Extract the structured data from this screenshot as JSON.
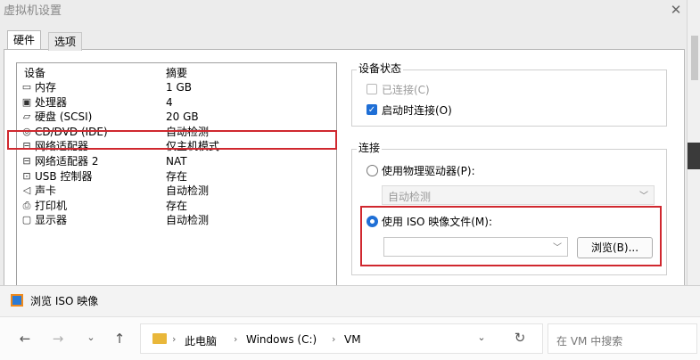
{
  "window": {
    "title": "虚拟机设置",
    "close_glyph": "✕"
  },
  "tabs": [
    {
      "label": "硬件",
      "active": true
    },
    {
      "label": "选项",
      "active": false
    }
  ],
  "device_list": {
    "col_device": "设备",
    "col_summary": "摘要",
    "rows": [
      {
        "icon": "memory-icon",
        "glyph": "▭",
        "name": "内存",
        "summary": "1 GB"
      },
      {
        "icon": "processor-icon",
        "glyph": "▣",
        "name": "处理器",
        "summary": "4"
      },
      {
        "icon": "harddisk-icon",
        "glyph": "▱",
        "name": "硬盘 (SCSI)",
        "summary": "20 GB"
      },
      {
        "icon": "cd-dvd-icon",
        "glyph": "◎",
        "name": "CD/DVD (IDE)",
        "summary": "自动检测",
        "selected": true
      },
      {
        "icon": "network-adapter-icon",
        "glyph": "⊟",
        "name": "网络适配器",
        "summary": "仅主机模式"
      },
      {
        "icon": "network-adapter-icon",
        "glyph": "⊟",
        "name": "网络适配器 2",
        "summary": "NAT"
      },
      {
        "icon": "usb-controller-icon",
        "glyph": "⊡",
        "name": "USB 控制器",
        "summary": "存在"
      },
      {
        "icon": "sound-card-icon",
        "glyph": "◁",
        "name": "声卡",
        "summary": "自动检测"
      },
      {
        "icon": "printer-icon",
        "glyph": "⎙",
        "name": "打印机",
        "summary": "存在"
      },
      {
        "icon": "display-icon",
        "glyph": "▢",
        "name": "显示器",
        "summary": "自动检测"
      }
    ]
  },
  "device_status": {
    "title": "设备状态",
    "connected_label": "已连接(C)",
    "connected_checked": false,
    "connect_at_poweron_label": "启动时连接(O)",
    "connect_at_poweron_checked": true
  },
  "connection": {
    "title": "连接",
    "physical_drive_label": "使用物理驱动器(P):",
    "physical_drive_value": "自动检测",
    "iso_label": "使用 ISO 映像文件(M):",
    "iso_value": "",
    "browse_label": "浏览(B)...",
    "selected": "iso"
  },
  "browse_dialog": {
    "title": "浏览 ISO 映像",
    "path": [
      "此电脑",
      "Windows (C:)",
      "VM"
    ],
    "search_placeholder": "在 VM 中搜索"
  },
  "colors": {
    "accent": "#1f6fd6",
    "highlight_box": "#d0282f"
  }
}
